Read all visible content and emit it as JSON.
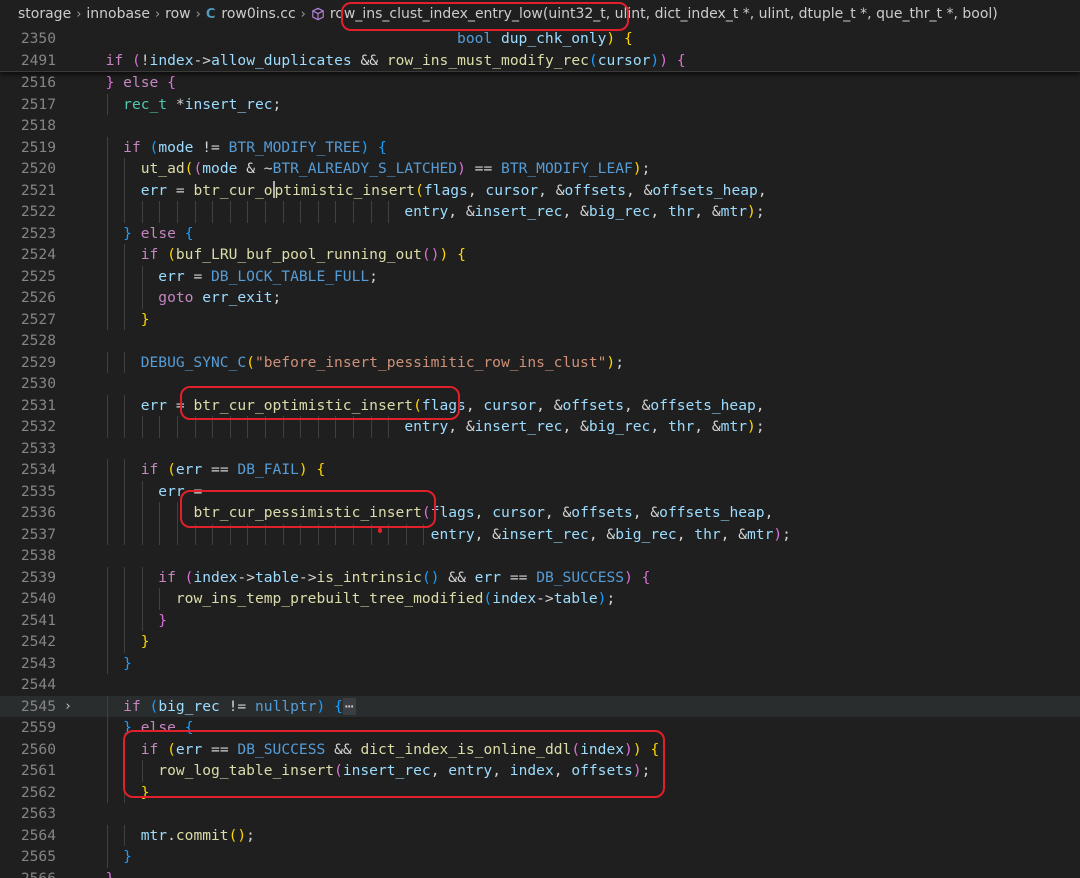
{
  "breadcrumb": {
    "items": [
      "storage",
      "innobase",
      "row"
    ],
    "file_icon": "C",
    "file": "row0ins.cc",
    "symbol_icon": "cube-icon",
    "symbol": "row_ins_clust_index_entry_low(uint32_t, ulint, dict_index_t *, ulint, dtuple_t *, que_thr_t *, bool)"
  },
  "sticky_lines": [
    {
      "num": "2350",
      "segments": [
        [
          "p",
          "                                          "
        ],
        [
          "kw",
          "bool"
        ],
        [
          "p",
          " "
        ],
        [
          "var",
          "dup_chk_only"
        ],
        [
          "b1",
          ")"
        ],
        [
          "p",
          " "
        ],
        [
          "b1",
          "{"
        ]
      ]
    },
    {
      "num": "2491",
      "segments": [
        [
          "p",
          "  "
        ],
        [
          "ctl",
          "if"
        ],
        [
          "p",
          " "
        ],
        [
          "b2",
          "("
        ],
        [
          "p",
          "!"
        ],
        [
          "var",
          "index"
        ],
        [
          "p",
          "->"
        ],
        [
          "var",
          "allow_duplicates"
        ],
        [
          "p",
          " && "
        ],
        [
          "fn",
          "row_ins_must_modify_rec"
        ],
        [
          "b3",
          "("
        ],
        [
          "var",
          "cursor"
        ],
        [
          "b3",
          ")"
        ],
        [
          "b2",
          ")"
        ],
        [
          "p",
          " "
        ],
        [
          "b2",
          "{"
        ]
      ]
    }
  ],
  "lines": [
    {
      "num": "2516",
      "segments": [
        [
          "p",
          "  "
        ],
        [
          "b2",
          "}"
        ],
        [
          "p",
          " "
        ],
        [
          "ctl",
          "else"
        ],
        [
          "p",
          " "
        ],
        [
          "b2",
          "{"
        ]
      ]
    },
    {
      "num": "2517",
      "segments": [
        [
          "p",
          "    "
        ],
        [
          "typ",
          "rec_t"
        ],
        [
          "p",
          " *"
        ],
        [
          "var",
          "insert_rec"
        ],
        [
          "p",
          ";"
        ]
      ]
    },
    {
      "num": "2518",
      "segments": []
    },
    {
      "num": "2519",
      "segments": [
        [
          "p",
          "    "
        ],
        [
          "ctl",
          "if"
        ],
        [
          "p",
          " "
        ],
        [
          "b3",
          "("
        ],
        [
          "var",
          "mode"
        ],
        [
          "p",
          " != "
        ],
        [
          "mac",
          "BTR_MODIFY_TREE"
        ],
        [
          "b3",
          ")"
        ],
        [
          "p",
          " "
        ],
        [
          "b3",
          "{"
        ]
      ]
    },
    {
      "num": "2520",
      "segments": [
        [
          "p",
          "      "
        ],
        [
          "fn",
          "ut_ad"
        ],
        [
          "b1",
          "("
        ],
        [
          "b2",
          "("
        ],
        [
          "var",
          "mode"
        ],
        [
          "p",
          " & ~"
        ],
        [
          "mac",
          "BTR_ALREADY_S_LATCHED"
        ],
        [
          "b2",
          ")"
        ],
        [
          "p",
          " == "
        ],
        [
          "mac",
          "BTR_MODIFY_LEAF"
        ],
        [
          "b1",
          ")"
        ],
        [
          "p",
          ";"
        ]
      ]
    },
    {
      "num": "2521",
      "cursor": true,
      "segments": [
        [
          "p",
          "      "
        ],
        [
          "var",
          "err"
        ],
        [
          "p",
          " = "
        ],
        [
          "fn",
          "btr_cur_o"
        ],
        [
          "cursor",
          ""
        ],
        [
          "fn",
          "ptimistic_insert"
        ],
        [
          "b1",
          "("
        ],
        [
          "var",
          "flags"
        ],
        [
          "p",
          ", "
        ],
        [
          "var",
          "cursor"
        ],
        [
          "p",
          ", &"
        ],
        [
          "var",
          "offsets"
        ],
        [
          "p",
          ", &"
        ],
        [
          "var",
          "offsets_heap"
        ],
        [
          "p",
          ","
        ]
      ]
    },
    {
      "num": "2522",
      "segments": [
        [
          "p",
          "                                    "
        ],
        [
          "var",
          "entry"
        ],
        [
          "p",
          ", &"
        ],
        [
          "var",
          "insert_rec"
        ],
        [
          "p",
          ", &"
        ],
        [
          "var",
          "big_rec"
        ],
        [
          "p",
          ", "
        ],
        [
          "var",
          "thr"
        ],
        [
          "p",
          ", &"
        ],
        [
          "var",
          "mtr"
        ],
        [
          "b1",
          ")"
        ],
        [
          "p",
          ";"
        ]
      ]
    },
    {
      "num": "2523",
      "segments": [
        [
          "p",
          "    "
        ],
        [
          "b3",
          "}"
        ],
        [
          "p",
          " "
        ],
        [
          "ctl",
          "else"
        ],
        [
          "p",
          " "
        ],
        [
          "b3",
          "{"
        ]
      ]
    },
    {
      "num": "2524",
      "segments": [
        [
          "p",
          "      "
        ],
        [
          "ctl",
          "if"
        ],
        [
          "p",
          " "
        ],
        [
          "b1",
          "("
        ],
        [
          "fn",
          "buf_LRU_buf_pool_running_out"
        ],
        [
          "b2",
          "()"
        ],
        [
          "b1",
          ")"
        ],
        [
          "p",
          " "
        ],
        [
          "b1",
          "{"
        ]
      ]
    },
    {
      "num": "2525",
      "segments": [
        [
          "p",
          "        "
        ],
        [
          "var",
          "err"
        ],
        [
          "p",
          " = "
        ],
        [
          "mac",
          "DB_LOCK_TABLE_FULL"
        ],
        [
          "p",
          ";"
        ]
      ]
    },
    {
      "num": "2526",
      "segments": [
        [
          "p",
          "        "
        ],
        [
          "ctl",
          "goto"
        ],
        [
          "p",
          " "
        ],
        [
          "var",
          "err_exit"
        ],
        [
          "p",
          ";"
        ]
      ]
    },
    {
      "num": "2527",
      "segments": [
        [
          "p",
          "      "
        ],
        [
          "b1",
          "}"
        ]
      ]
    },
    {
      "num": "2528",
      "segments": []
    },
    {
      "num": "2529",
      "segments": [
        [
          "p",
          "      "
        ],
        [
          "mac",
          "DEBUG_SYNC_C"
        ],
        [
          "b1",
          "("
        ],
        [
          "str",
          "\"before_insert_pessimitic_row_ins_clust\""
        ],
        [
          "b1",
          ")"
        ],
        [
          "p",
          ";"
        ]
      ]
    },
    {
      "num": "2530",
      "segments": []
    },
    {
      "num": "2531",
      "segments": [
        [
          "p",
          "      "
        ],
        [
          "var",
          "err"
        ],
        [
          "p",
          " = "
        ],
        [
          "fn",
          "btr_cur_optimistic_insert"
        ],
        [
          "b1",
          "("
        ],
        [
          "var",
          "flags"
        ],
        [
          "p",
          ", "
        ],
        [
          "var",
          "cursor"
        ],
        [
          "p",
          ", &"
        ],
        [
          "var",
          "offsets"
        ],
        [
          "p",
          ", &"
        ],
        [
          "var",
          "offsets_heap"
        ],
        [
          "p",
          ","
        ]
      ]
    },
    {
      "num": "2532",
      "segments": [
        [
          "p",
          "                                    "
        ],
        [
          "var",
          "entry"
        ],
        [
          "p",
          ", &"
        ],
        [
          "var",
          "insert_rec"
        ],
        [
          "p",
          ", &"
        ],
        [
          "var",
          "big_rec"
        ],
        [
          "p",
          ", "
        ],
        [
          "var",
          "thr"
        ],
        [
          "p",
          ", &"
        ],
        [
          "var",
          "mtr"
        ],
        [
          "b1",
          ")"
        ],
        [
          "p",
          ";"
        ]
      ]
    },
    {
      "num": "2533",
      "segments": []
    },
    {
      "num": "2534",
      "segments": [
        [
          "p",
          "      "
        ],
        [
          "ctl",
          "if"
        ],
        [
          "p",
          " "
        ],
        [
          "b1",
          "("
        ],
        [
          "var",
          "err"
        ],
        [
          "p",
          " == "
        ],
        [
          "mac",
          "DB_FAIL"
        ],
        [
          "b1",
          ")"
        ],
        [
          "p",
          " "
        ],
        [
          "b1",
          "{"
        ]
      ]
    },
    {
      "num": "2535",
      "segments": [
        [
          "p",
          "        "
        ],
        [
          "var",
          "err"
        ],
        [
          "p",
          " ="
        ]
      ]
    },
    {
      "num": "2536",
      "segments": [
        [
          "p",
          "            "
        ],
        [
          "fn",
          "btr_cur_pessimistic_insert"
        ],
        [
          "b2",
          "("
        ],
        [
          "var",
          "flags"
        ],
        [
          "p",
          ", "
        ],
        [
          "var",
          "cursor"
        ],
        [
          "p",
          ", &"
        ],
        [
          "var",
          "offsets"
        ],
        [
          "p",
          ", &"
        ],
        [
          "var",
          "offsets_heap"
        ],
        [
          "p",
          ","
        ]
      ]
    },
    {
      "num": "2537",
      "segments": [
        [
          "p",
          "                                       "
        ],
        [
          "var",
          "entry"
        ],
        [
          "p",
          ", &"
        ],
        [
          "var",
          "insert_rec"
        ],
        [
          "p",
          ", &"
        ],
        [
          "var",
          "big_rec"
        ],
        [
          "p",
          ", "
        ],
        [
          "var",
          "thr"
        ],
        [
          "p",
          ", &"
        ],
        [
          "var",
          "mtr"
        ],
        [
          "b2",
          ")"
        ],
        [
          "p",
          ";"
        ]
      ]
    },
    {
      "num": "2538",
      "segments": []
    },
    {
      "num": "2539",
      "segments": [
        [
          "p",
          "        "
        ],
        [
          "ctl",
          "if"
        ],
        [
          "p",
          " "
        ],
        [
          "b2",
          "("
        ],
        [
          "var",
          "index"
        ],
        [
          "p",
          "->"
        ],
        [
          "var",
          "table"
        ],
        [
          "p",
          "->"
        ],
        [
          "fn",
          "is_intrinsic"
        ],
        [
          "b3",
          "()"
        ],
        [
          "p",
          " && "
        ],
        [
          "var",
          "err"
        ],
        [
          "p",
          " == "
        ],
        [
          "mac",
          "DB_SUCCESS"
        ],
        [
          "b2",
          ")"
        ],
        [
          "p",
          " "
        ],
        [
          "b2",
          "{"
        ]
      ]
    },
    {
      "num": "2540",
      "segments": [
        [
          "p",
          "          "
        ],
        [
          "fn",
          "row_ins_temp_prebuilt_tree_modified"
        ],
        [
          "b3",
          "("
        ],
        [
          "var",
          "index"
        ],
        [
          "p",
          "->"
        ],
        [
          "var",
          "table"
        ],
        [
          "b3",
          ")"
        ],
        [
          "p",
          ";"
        ]
      ]
    },
    {
      "num": "2541",
      "segments": [
        [
          "p",
          "        "
        ],
        [
          "b2",
          "}"
        ]
      ]
    },
    {
      "num": "2542",
      "segments": [
        [
          "p",
          "      "
        ],
        [
          "b1",
          "}"
        ]
      ]
    },
    {
      "num": "2543",
      "segments": [
        [
          "p",
          "    "
        ],
        [
          "b3",
          "}"
        ]
      ]
    },
    {
      "num": "2544",
      "segments": []
    },
    {
      "num": "2545",
      "fold": "›",
      "highlight": true,
      "segments": [
        [
          "p",
          "    "
        ],
        [
          "ctl",
          "if"
        ],
        [
          "p",
          " "
        ],
        [
          "b3",
          "("
        ],
        [
          "var",
          "big_rec"
        ],
        [
          "p",
          " != "
        ],
        [
          "kw",
          "nullptr"
        ],
        [
          "b3",
          ")"
        ],
        [
          "p",
          " "
        ],
        [
          "b3",
          "{"
        ],
        [
          "ell",
          "⋯"
        ]
      ]
    },
    {
      "num": "2559",
      "segments": [
        [
          "p",
          "    "
        ],
        [
          "b3",
          "}"
        ],
        [
          "p",
          " "
        ],
        [
          "ctl",
          "else"
        ],
        [
          "p",
          " "
        ],
        [
          "b3",
          "{"
        ]
      ]
    },
    {
      "num": "2560",
      "segments": [
        [
          "p",
          "      "
        ],
        [
          "ctl",
          "if"
        ],
        [
          "p",
          " "
        ],
        [
          "b1",
          "("
        ],
        [
          "var",
          "err"
        ],
        [
          "p",
          " == "
        ],
        [
          "mac",
          "DB_SUCCESS"
        ],
        [
          "p",
          " && "
        ],
        [
          "fn",
          "dict_index_is_online_ddl"
        ],
        [
          "b2",
          "("
        ],
        [
          "var",
          "index"
        ],
        [
          "b2",
          ")"
        ],
        [
          "b1",
          ")"
        ],
        [
          "p",
          " "
        ],
        [
          "b1",
          "{"
        ]
      ]
    },
    {
      "num": "2561",
      "segments": [
        [
          "p",
          "        "
        ],
        [
          "fn",
          "row_log_table_insert"
        ],
        [
          "b2",
          "("
        ],
        [
          "var",
          "insert_rec"
        ],
        [
          "p",
          ", "
        ],
        [
          "var",
          "entry"
        ],
        [
          "p",
          ", "
        ],
        [
          "var",
          "index"
        ],
        [
          "p",
          ", "
        ],
        [
          "var",
          "offsets"
        ],
        [
          "b2",
          ")"
        ],
        [
          "p",
          ";"
        ]
      ]
    },
    {
      "num": "2562",
      "segments": [
        [
          "p",
          "      "
        ],
        [
          "b1",
          "}"
        ]
      ]
    },
    {
      "num": "2563",
      "segments": []
    },
    {
      "num": "2564",
      "segments": [
        [
          "p",
          "      "
        ],
        [
          "var",
          "mtr"
        ],
        [
          "p",
          "."
        ],
        [
          "fn",
          "commit"
        ],
        [
          "b1",
          "()"
        ],
        [
          "p",
          ";"
        ]
      ]
    },
    {
      "num": "2565",
      "segments": [
        [
          "p",
          "    "
        ],
        [
          "b3",
          "}"
        ]
      ]
    },
    {
      "num": "2566",
      "segments": [
        [
          "p",
          "  "
        ],
        [
          "b2",
          "}"
        ]
      ]
    }
  ]
}
